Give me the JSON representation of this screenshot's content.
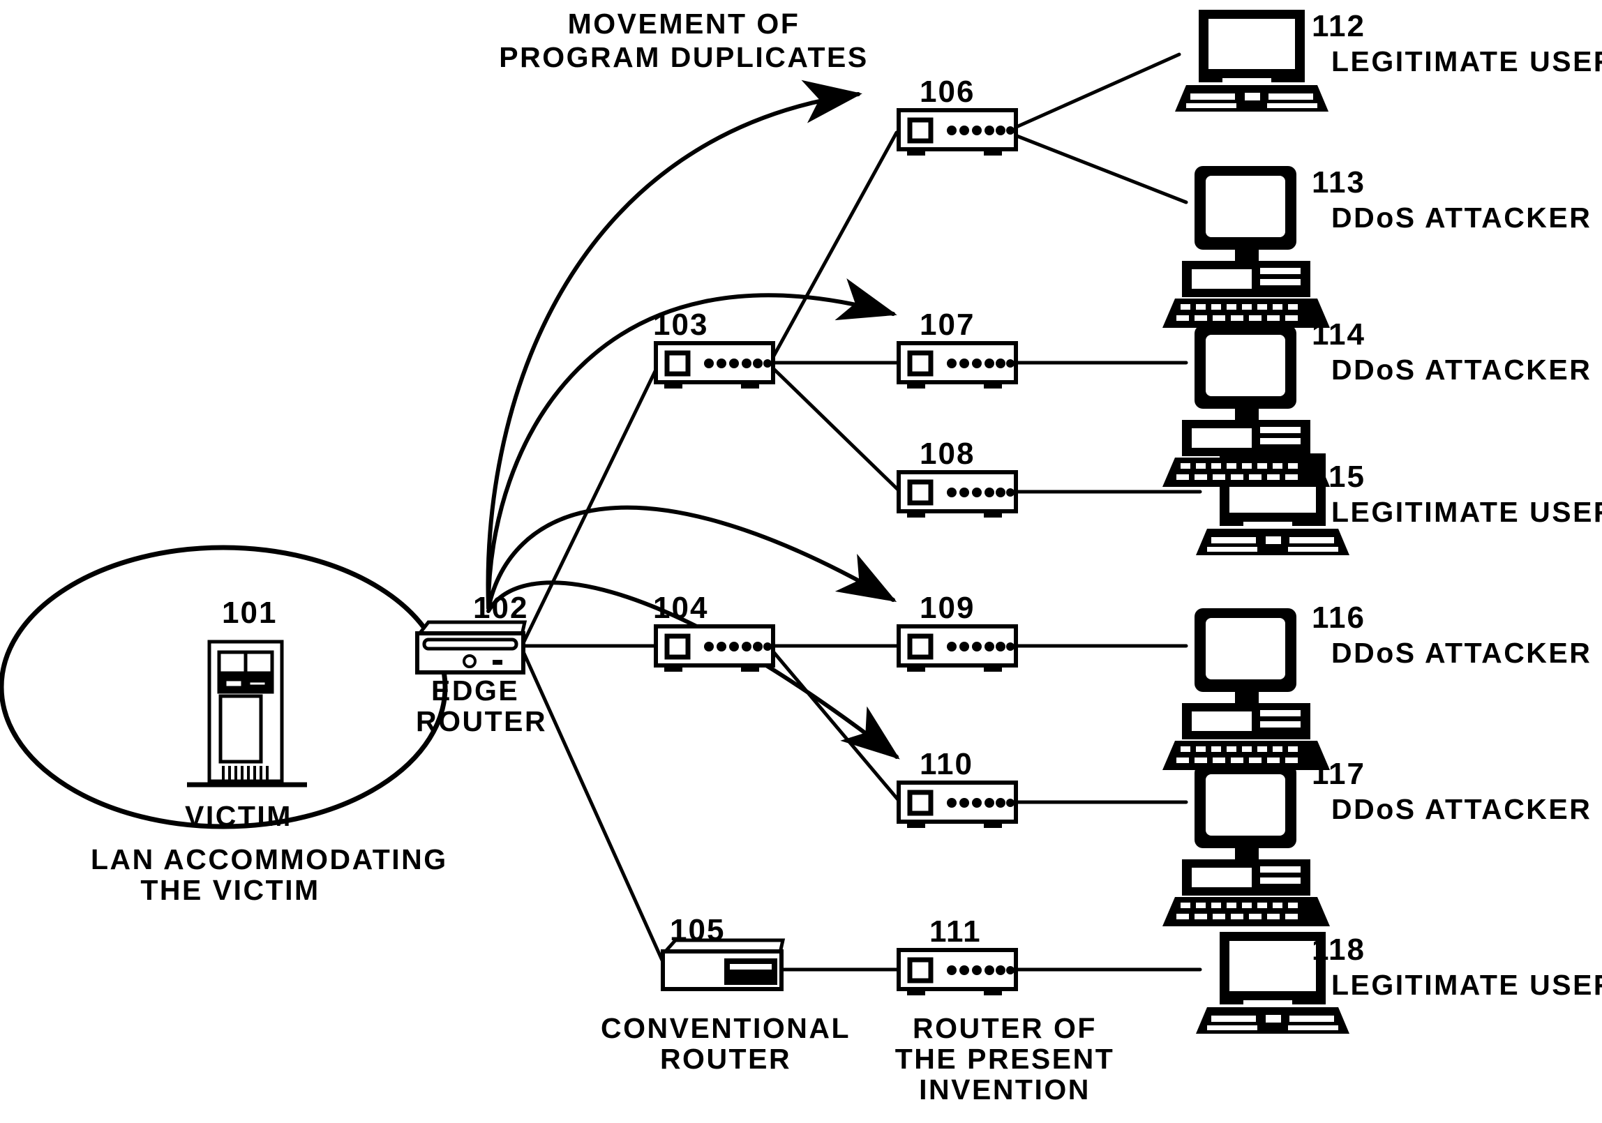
{
  "figure": {
    "title": "MOVEMENT OF\nPROGRAM DUPLICATES",
    "title_line1": "MOVEMENT OF",
    "title_line2": "PROGRAM DUPLICATES",
    "ink_color": "#000000",
    "background_color": "#ffffff"
  },
  "lan": {
    "label_line1": "LAN ACCOMMODATING",
    "label_line2": "THE VICTIM",
    "shape": "ellipse"
  },
  "nodes": {
    "victim": {
      "ref": "101",
      "caption": "VICTIM",
      "icon": "server-tower-icon"
    },
    "edge_router": {
      "ref": "102",
      "caption_line1": "EDGE",
      "caption_line2": "ROUTER",
      "icon": "edge-router-icon"
    },
    "conventional_router": {
      "ref": "105",
      "caption_line1": "CONVENTIONAL",
      "caption_line2": "ROUTER",
      "icon": "conventional-router-icon"
    },
    "invention_router": {
      "ref": "111",
      "caption_line1": "ROUTER OF",
      "caption_line2": "THE PRESENT",
      "caption_line3": "INVENTION",
      "icon": "router-icon"
    }
  },
  "routers": [
    {
      "ref": "103",
      "icon": "router-icon"
    },
    {
      "ref": "104",
      "icon": "router-icon"
    },
    {
      "ref": "106",
      "icon": "router-icon"
    },
    {
      "ref": "107",
      "icon": "router-icon"
    },
    {
      "ref": "108",
      "icon": "router-icon"
    },
    {
      "ref": "109",
      "icon": "router-icon"
    },
    {
      "ref": "110",
      "icon": "router-icon"
    }
  ],
  "hosts": [
    {
      "ref": "112",
      "label": "LEGITIMATE USER",
      "icon": "laptop-icon"
    },
    {
      "ref": "113",
      "label": "DDoS ATTACKER",
      "icon": "desktop-computer-icon"
    },
    {
      "ref": "114",
      "label": "DDoS ATTACKER",
      "icon": "desktop-computer-icon"
    },
    {
      "ref": "115",
      "label": "LEGITIMATE USER",
      "icon": "laptop-icon"
    },
    {
      "ref": "116",
      "label": "DDoS ATTACKER",
      "icon": "desktop-computer-icon"
    },
    {
      "ref": "117",
      "label": "DDoS ATTACKER",
      "icon": "desktop-computer-icon"
    },
    {
      "ref": "118",
      "label": "LEGITIMATE USER",
      "icon": "laptop-icon"
    }
  ]
}
